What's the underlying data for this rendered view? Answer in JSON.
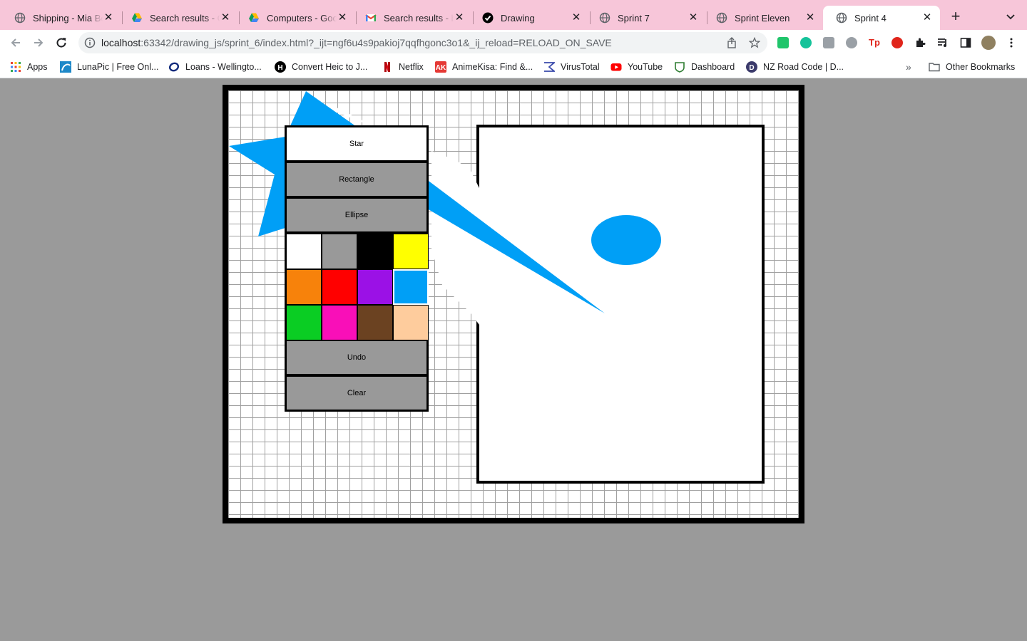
{
  "tabs": [
    {
      "title": "Shipping - Mia Be",
      "icon": "globe-icon"
    },
    {
      "title": "Search results - G",
      "icon": "google-drive-icon"
    },
    {
      "title": "Computers - Goo",
      "icon": "google-drive-icon"
    },
    {
      "title": "Search results - b",
      "icon": "gmail-icon"
    },
    {
      "title": "Drawing",
      "icon": "checkmark-circle-icon"
    },
    {
      "title": "Sprint 7",
      "icon": "globe-icon"
    },
    {
      "title": "Sprint Eleven",
      "icon": "globe-icon"
    },
    {
      "title": "Sprint 4",
      "icon": "globe-icon",
      "active": true
    }
  ],
  "address_bar": {
    "host": "localhost",
    "rest": ":63342/drawing_js/sprint_6/index.html?_ijt=ngf6u4s9pakioj7qqfhgonc3o1&_ij_reload=RELOAD_ON_SAVE"
  },
  "bookmarks": [
    {
      "label": "Apps",
      "icon": "apps-grid-icon"
    },
    {
      "label": "LunaPic | Free Onl...",
      "icon": "lunapic-icon"
    },
    {
      "label": "Loans - Wellingto...",
      "icon": "loans-icon"
    },
    {
      "label": "Convert Heic to J...",
      "icon": "heic-icon"
    },
    {
      "label": "Netflix",
      "icon": "netflix-icon"
    },
    {
      "label": "AnimeKisa: Find &...",
      "icon": "animekisa-icon"
    },
    {
      "label": "VirusTotal",
      "icon": "virustotal-icon"
    },
    {
      "label": "YouTube",
      "icon": "youtube-icon"
    },
    {
      "label": "Dashboard",
      "icon": "dashboard-icon"
    },
    {
      "label": "NZ Road Code | D...",
      "icon": "road-code-icon"
    }
  ],
  "other_bookmarks": "Other Bookmarks",
  "panel": {
    "star_label": "Star",
    "rectangle_label": "Rectangle",
    "ellipse_label": "Ellipse",
    "undo_label": "Undo",
    "clear_label": "Clear",
    "selected_shape": "Star",
    "swatches": [
      "#ffffff",
      "#999999",
      "#000000",
      "#ffff00",
      "#f7820b",
      "#ff0000",
      "#9b11e6",
      "#009ff6",
      "#0acd23",
      "#f90fb8",
      "#6b4221",
      "#fecc9d"
    ],
    "selected_color": "#009ff6"
  },
  "colors": {
    "tab_strip": "#f7c6d9",
    "page_background": "#9a9a9a",
    "button_gray": "#999999",
    "shape_fill": "#009ff6"
  }
}
